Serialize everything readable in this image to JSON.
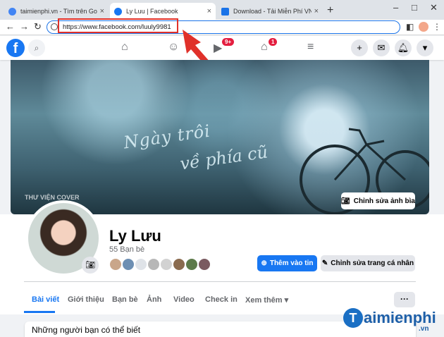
{
  "browser": {
    "tabs": [
      {
        "title": "taimienphi.vn - Tìm trên Google",
        "close": "×"
      },
      {
        "title": "Ly Luu | Facebook",
        "close": "×"
      },
      {
        "title": "Download - Tải Miễn Phí VN - Ph",
        "close": "×"
      }
    ],
    "new_tab": "+",
    "url": "https://www.facebook.com/luuly9981"
  },
  "facebook": {
    "logo": "f",
    "messenger_badge": "9+",
    "marketplace_badge": "1"
  },
  "cover": {
    "caption_line1": "Ngày trôi",
    "caption_line2": "về phía cũ",
    "watermark": "THƯ VIỆN COVER",
    "edit_label": "Chỉnh sửa ảnh bìa"
  },
  "profile": {
    "name": "Ly Lưu",
    "friends": "55 Bạn bè",
    "add_story": "Thêm vào tin",
    "edit_profile": "Chỉnh sửa trang cá nhân"
  },
  "tabs": [
    "Bài viết",
    "Giới thiệu",
    "Bạn bè",
    "Ảnh",
    "Video",
    "Check in",
    "Xem thêm"
  ],
  "more": "···",
  "people_card_title": "Những người bạn có thể biết",
  "watermark_brand": {
    "letter": "T",
    "text": "aimienphi",
    "suffix": ".vn"
  }
}
